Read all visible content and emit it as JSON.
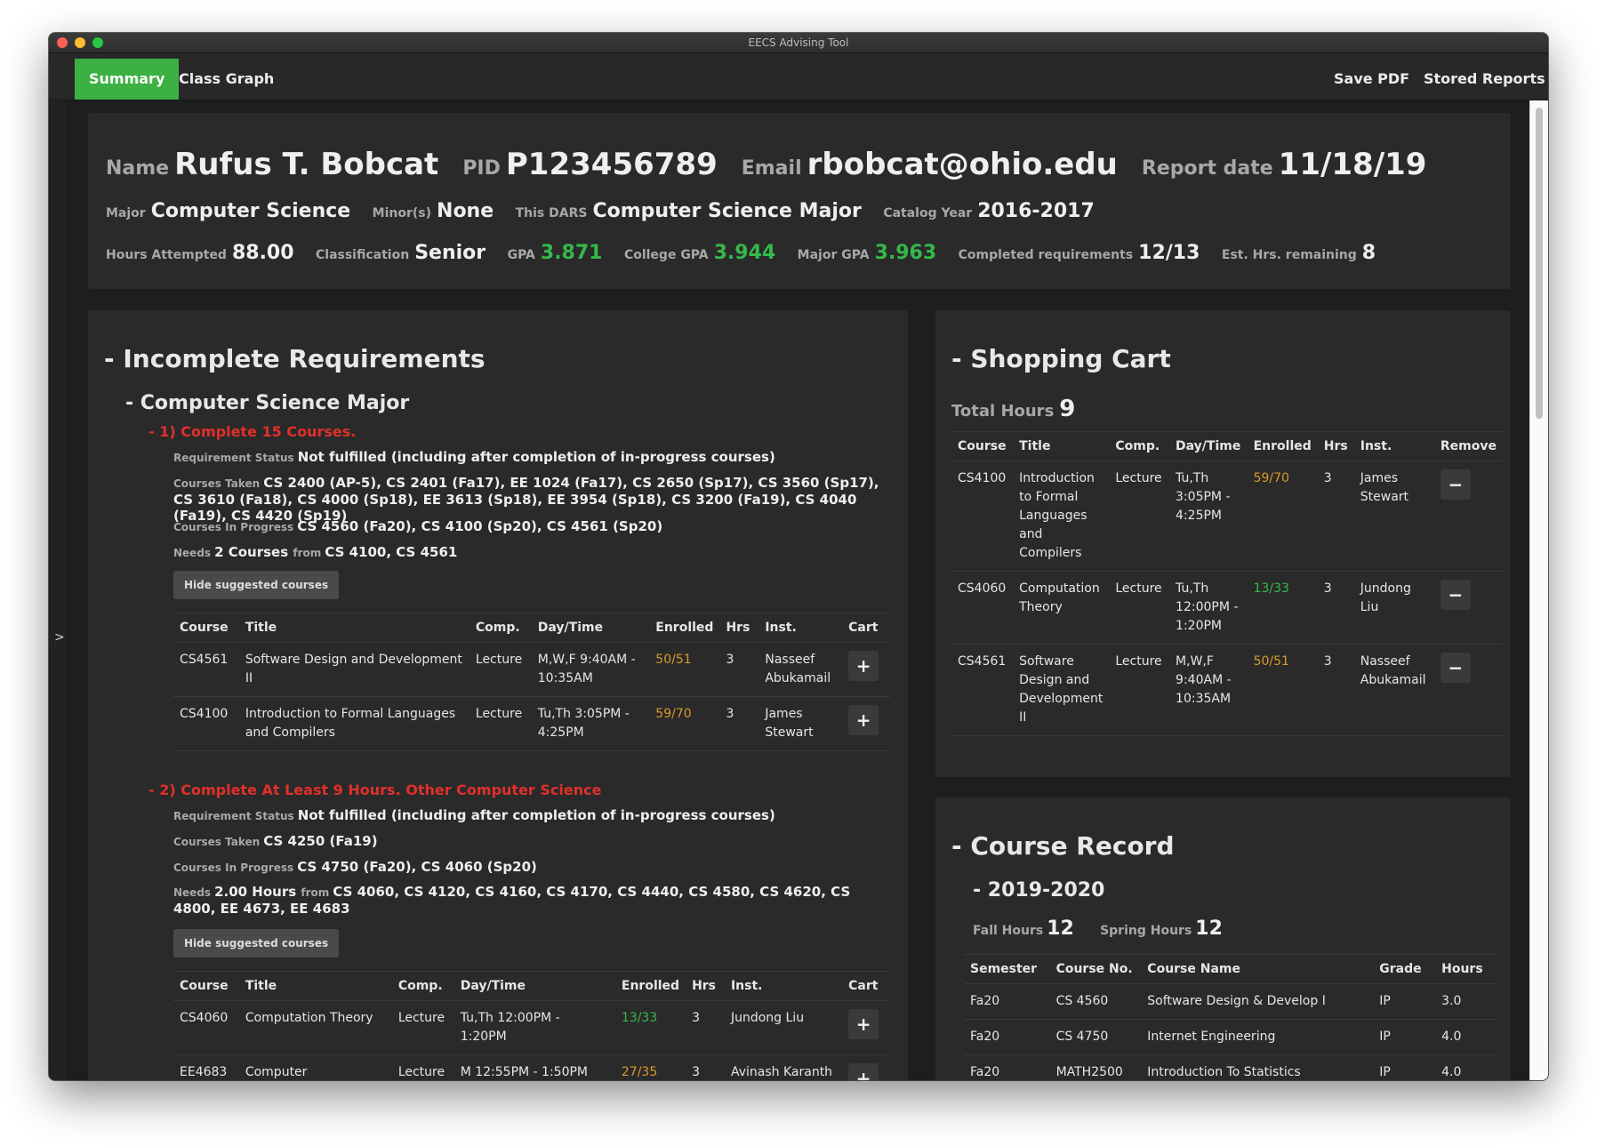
{
  "window": {
    "title": "EECS Advising Tool"
  },
  "toolbar": {
    "tabs": [
      {
        "label": "Summary",
        "active": true
      },
      {
        "label": "Class Graph",
        "active": false
      }
    ],
    "save_pdf": "Save PDF",
    "stored_reports": "Stored Reports"
  },
  "gutter": {
    "toggle": ">"
  },
  "summary": {
    "name_label": "Name",
    "name": "Rufus T. Bobcat",
    "pid_label": "PID",
    "pid": "P123456789",
    "email_label": "Email",
    "email": "rbobcat@ohio.edu",
    "report_label": "Report date",
    "report_date": "11/18/19",
    "major_label": "Major",
    "major": "Computer Science",
    "minor_label": "Minor(s)",
    "minor": "None",
    "dars_label": "This DARS",
    "dars": "Computer Science Major",
    "catalog_label": "Catalog Year",
    "catalog": "2016-2017",
    "hours_label": "Hours Attempted",
    "hours": "88.00",
    "class_label": "Classification",
    "classification": "Senior",
    "gpa_label": "GPA",
    "gpa": "3.871",
    "college_gpa_label": "College GPA",
    "college_gpa": "3.944",
    "major_gpa_label": "Major GPA",
    "major_gpa": "3.963",
    "completed_label": "Completed requirements",
    "completed": "12/13",
    "remaining_label": "Est. Hrs. remaining",
    "remaining": "8"
  },
  "incomplete": {
    "title": "- Incomplete Requirements",
    "major_title": "- Computer Science Major",
    "req1": {
      "title": "- 1) Complete 15 Courses.",
      "status_label": "Requirement Status",
      "status": "Not fulfilled (including after completion of in-progress courses)",
      "taken_label": "Courses Taken",
      "taken": "CS 2400 (AP-5), CS 2401 (Fa17), EE 1024 (Fa17), CS 2650 (Sp17), CS 3560 (Sp17), CS 3610 (Fa18), CS 4000 (Sp18), EE 3613 (Sp18), EE 3954 (Sp18), CS 3200 (Fa19), CS 4040 (Fa19), CS 4420 (Sp19)",
      "progress_label": "Courses In Progress",
      "progress": "CS 4560 (Fa20), CS 4100 (Sp20), CS 4561 (Sp20)",
      "needs_label": "Needs",
      "needs": "2 Courses",
      "from_label": "from",
      "needs_from": "CS 4100, CS 4561",
      "hide_btn": "Hide suggested courses",
      "headers": [
        "Course",
        "Title",
        "Comp.",
        "Day/Time",
        "Enrolled",
        "Hrs",
        "Inst.",
        "Cart"
      ],
      "rows": [
        {
          "course": "CS4561",
          "title": "Software Design and Development II",
          "comp": "Lecture",
          "time": "M,W,F 9:40AM - 10:35AM",
          "enrolled": "50/51",
          "hrs": "3",
          "inst": "Nasseef Abukamail"
        },
        {
          "course": "CS4100",
          "title": "Introduction to Formal Languages and Compilers",
          "comp": "Lecture",
          "time": "Tu,Th 3:05PM - 4:25PM",
          "enrolled": "59/70",
          "hrs": "3",
          "inst": "James Stewart"
        }
      ],
      "add_icon": "+"
    },
    "req2": {
      "title": "- 2) Complete At Least 9 Hours. Other Computer Science",
      "status_label": "Requirement Status",
      "status": "Not fulfilled (including after completion of in-progress courses)",
      "taken_label": "Courses Taken",
      "taken": "CS 4250 (Fa19)",
      "progress_label": "Courses In Progress",
      "progress": "CS 4750 (Fa20), CS 4060 (Sp20)",
      "needs_label": "Needs",
      "needs": "2.00 Hours",
      "from_label": "from",
      "needs_from": "CS 4060, CS 4120, CS 4160, CS 4170, CS 4440, CS 4580, CS 4620, CS 4800, EE 4673, EE 4683",
      "hide_btn": "Hide suggested courses",
      "headers": [
        "Course",
        "Title",
        "Comp.",
        "Day/Time",
        "Enrolled",
        "Hrs",
        "Inst.",
        "Cart"
      ],
      "rows": [
        {
          "course": "CS4060",
          "title": "Computation Theory",
          "comp": "Lecture",
          "time": "Tu,Th 12:00PM - 1:20PM",
          "enrolled": "13/33",
          "hrs": "3",
          "inst": "Jundong Liu"
        },
        {
          "course": "EE4683",
          "title": "Computer Architecture",
          "comp": "Lecture",
          "time": "M 12:55PM - 1:50PM",
          "enrolled": "27/35",
          "hrs": "3",
          "inst": "Avinash Karanth"
        }
      ],
      "add_icon": "+"
    }
  },
  "cart": {
    "title": "- Shopping Cart",
    "total_label": "Total Hours",
    "total": "9",
    "headers": [
      "Course",
      "Title",
      "Comp.",
      "Day/Time",
      "Enrolled",
      "Hrs",
      "Inst.",
      "Remove"
    ],
    "rows": [
      {
        "course": "CS4100",
        "title": "Introduction to Formal Languages and Compilers",
        "comp": "Lecture",
        "time": "Tu,Th 3:05PM - 4:25PM",
        "enrolled": "59/70",
        "hrs": "3",
        "inst": "James Stewart"
      },
      {
        "course": "CS4060",
        "title": "Computation Theory",
        "comp": "Lecture",
        "time": "Tu,Th 12:00PM - 1:20PM",
        "enrolled": "13/33",
        "hrs": "3",
        "inst": "Jundong Liu"
      },
      {
        "course": "CS4561",
        "title": "Software Design and Development II",
        "comp": "Lecture",
        "time": "M,W,F 9:40AM - 10:35AM",
        "enrolled": "50/51",
        "hrs": "3",
        "inst": "Nasseef Abukamail"
      }
    ],
    "remove_icon": "−"
  },
  "record": {
    "title": "- Course Record",
    "year": "- 2019-2020",
    "fall_label": "Fall Hours",
    "fall": "12",
    "spring_label": "Spring Hours",
    "spring": "12",
    "headers": [
      "Semester",
      "Course No.",
      "Course Name",
      "Grade",
      "Hours"
    ],
    "rows": [
      {
        "sem": "Fa20",
        "no": "CS 4560",
        "name": "Software Design & Develop I",
        "grade": "IP",
        "hours": "3.0"
      },
      {
        "sem": "Fa20",
        "no": "CS 4750",
        "name": "Internet Engineering",
        "grade": "IP",
        "hours": "4.0"
      },
      {
        "sem": "Fa20",
        "no": "MATH2500",
        "name": "Introduction To Statistics",
        "grade": "IP",
        "hours": "4.0"
      }
    ]
  }
}
